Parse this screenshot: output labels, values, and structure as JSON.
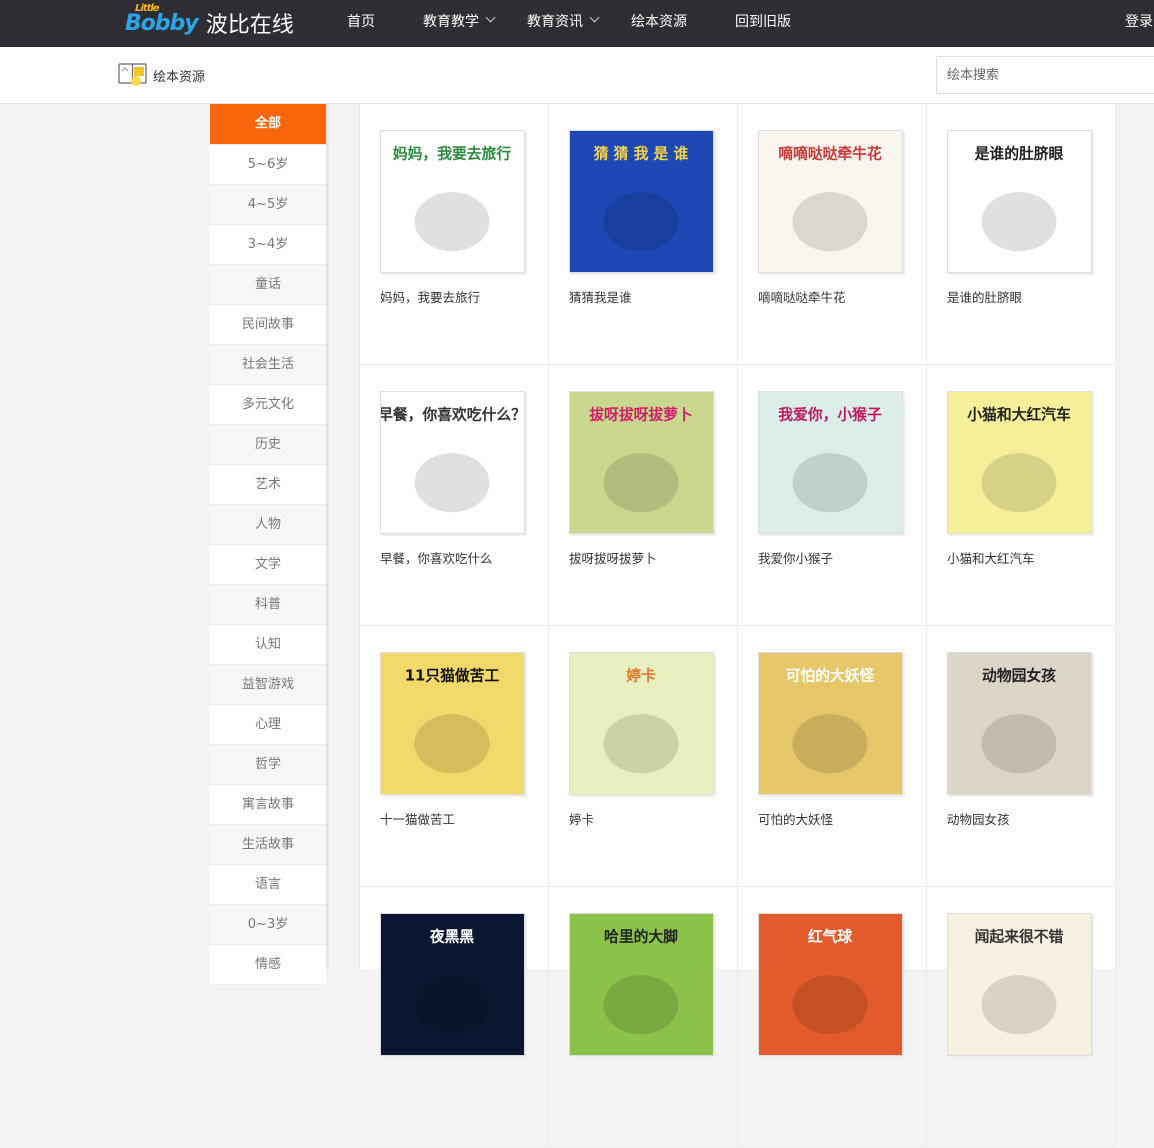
{
  "header": {
    "logo_mark": "Bobby",
    "logo_small": "Little",
    "site_name": "波比在线",
    "nav": [
      "首页",
      "教育教学",
      "教育资讯",
      "绘本资源",
      "回到旧版"
    ],
    "login": "登录"
  },
  "subheader": {
    "title": "绘本资源",
    "search_placeholder": "绘本搜索"
  },
  "categories": [
    "全部",
    "5~6岁",
    "4~5岁",
    "3~4岁",
    "童话",
    "民间故事",
    "社会生活",
    "多元文化",
    "历史",
    "艺术",
    "人物",
    "文学",
    "科普",
    "认知",
    "益智游戏",
    "心理",
    "哲学",
    "寓言故事",
    "生活故事",
    "语言",
    "0~3岁",
    "情感"
  ],
  "books": [
    {
      "title": "妈妈，我要去旅行",
      "cover_text": "妈妈，我要去旅行",
      "bg": "#ffffff",
      "fg": "#2c8a3c"
    },
    {
      "title": "猜猜我是谁",
      "cover_text": "猜 猜 我 是 谁",
      "bg": "#1c47b5",
      "fg": "#f6d54a"
    },
    {
      "title": "嘀嘀哒哒牵牛花",
      "cover_text": "嘀嘀哒哒牵牛花",
      "bg": "#faf5ee",
      "fg": "#c73a3a"
    },
    {
      "title": "是谁的肚脐眼",
      "cover_text": "是谁的肚脐眼",
      "bg": "#ffffff",
      "fg": "#222222"
    },
    {
      "title": "早餐，你喜欢吃什么",
      "cover_text": "早餐，你喜欢吃什么？",
      "bg": "#ffffff",
      "fg": "#333333"
    },
    {
      "title": "拔呀拔呀拔萝卜",
      "cover_text": "拔呀拔呀拔萝卜",
      "bg": "#c9d88e",
      "fg": "#d1206a"
    },
    {
      "title": "我爱你小猴子",
      "cover_text": "我爱你，小猴子",
      "bg": "#dbeeea",
      "fg": "#c2185b"
    },
    {
      "title": "小猫和大红汽车",
      "cover_text": "小猫和大红汽车",
      "bg": "#f6ef9a",
      "fg": "#222222"
    },
    {
      "title": "十一猫做苦工",
      "cover_text": "11只猫做苦工",
      "bg": "#f3d86a",
      "fg": "#111111"
    },
    {
      "title": "婷卡",
      "cover_text": "婷卡",
      "bg": "#e8efc0",
      "fg": "#e07a2c"
    },
    {
      "title": "可怕的大妖怪",
      "cover_text": "可怕的大妖怪",
      "bg": "#e6c76a",
      "fg": "#ffffff"
    },
    {
      "title": "动物园女孩",
      "cover_text": "动物园女孩",
      "bg": "#dcd6c8",
      "fg": "#222222"
    },
    {
      "title": "",
      "cover_text": "夜黑黑",
      "bg": "#0b1730",
      "fg": "#ffffff"
    },
    {
      "title": "",
      "cover_text": "哈里的大脚",
      "bg": "#8ac24a",
      "fg": "#222222"
    },
    {
      "title": "",
      "cover_text": "红气球",
      "bg": "#e25b2c",
      "fg": "#ffffff"
    },
    {
      "title": "",
      "cover_text": "闻起来很不错",
      "bg": "#f7f1e2",
      "fg": "#333333"
    }
  ],
  "colors": {
    "topbar": "#2e2d33",
    "accent": "#f9650a",
    "logo_blue": "#2aa6e8"
  }
}
